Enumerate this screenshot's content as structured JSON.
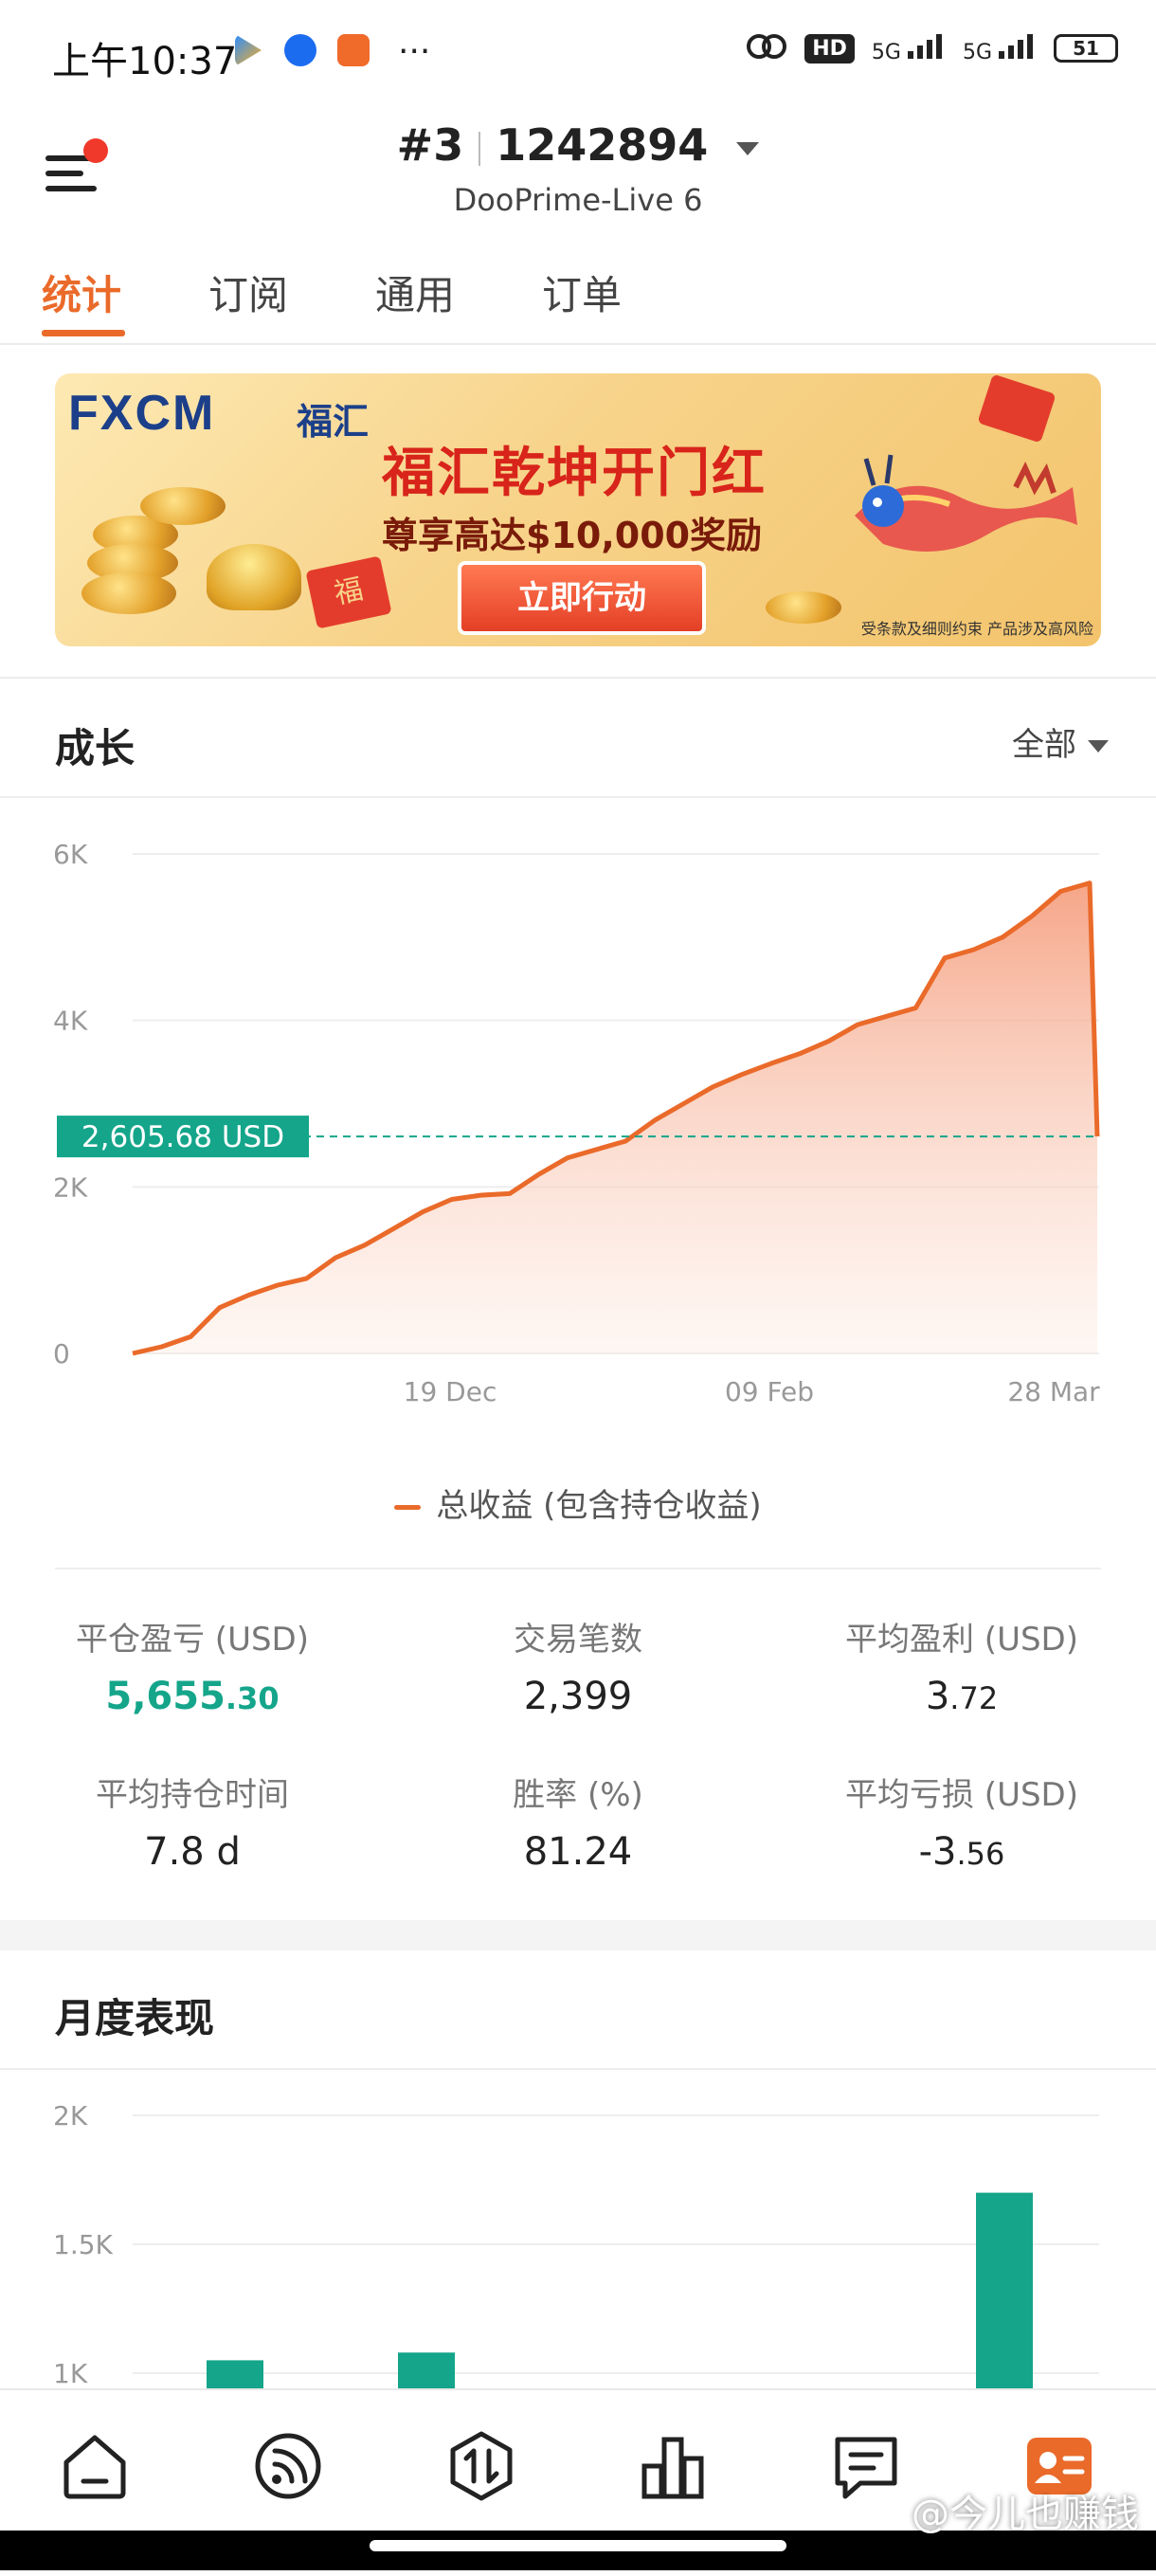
{
  "status_bar": {
    "time": "上午10:37",
    "more": "···",
    "hd": "HD",
    "sig1": "5G",
    "sig2": "5G",
    "battery": "51"
  },
  "header": {
    "account_index": "#3",
    "account_number": "1242894",
    "server": "DooPrime-Live 6"
  },
  "tabs": [
    {
      "label": "统计",
      "active": true
    },
    {
      "label": "订阅",
      "active": false
    },
    {
      "label": "通用",
      "active": false
    },
    {
      "label": "订单",
      "active": false
    }
  ],
  "banner": {
    "logo": "FXCM",
    "logo_cn": "福汇",
    "headline": "福汇乾坤开门红",
    "subline": "尊享高达$10,000奖励",
    "cta": "立即行动",
    "disclaimer": "受条款及细则约束  产品涉及高风险",
    "hongbao_char": "福"
  },
  "growth": {
    "title": "成长",
    "filter": "全部",
    "legend": "总收益 (包含持仓收益)",
    "current_label": "2,605.68 USD",
    "colors": {
      "line": "#ea6a2a",
      "accent": "#14a58a"
    }
  },
  "chart_data": [
    {
      "type": "area",
      "title": "",
      "xlabel": "",
      "ylabel": "",
      "x_ticks": [
        "19 Dec",
        "09 Feb",
        "28 Mar"
      ],
      "y_ticks": [
        "0",
        "2K",
        "4K",
        "6K"
      ],
      "ylim": [
        0,
        6000
      ],
      "current_value": 2605.68,
      "series": [
        {
          "name": "总收益 (包含持仓收益)",
          "values": [
            0,
            80,
            200,
            550,
            700,
            820,
            900,
            1150,
            1300,
            1500,
            1700,
            1850,
            1900,
            1920,
            2150,
            2350,
            2450,
            2550,
            2800,
            3000,
            3200,
            3350,
            3480,
            3600,
            3750,
            3950,
            4050,
            4150,
            4750,
            4850,
            5000,
            5250,
            5550,
            5650,
            2605.68
          ]
        }
      ],
      "grid": true
    },
    {
      "type": "bar",
      "title": "",
      "y_ticks": [
        "1K",
        "1.5K",
        "2K"
      ],
      "ylim": [
        1000,
        2000
      ],
      "series": [
        {
          "values": [
            1050,
            1080,
            1700
          ]
        }
      ],
      "grid": true
    }
  ],
  "stats": [
    {
      "label": "平仓盈亏 (USD)",
      "int": "5,655",
      "dec": ".30",
      "green": true
    },
    {
      "label": "交易笔数",
      "int": "2,399",
      "dec": "",
      "green": false
    },
    {
      "label": "平均盈利 (USD)",
      "int": "3",
      "dec": ".72",
      "green": false
    },
    {
      "label": "平均持仓时间",
      "int": "7.8 d",
      "dec": "",
      "green": false
    },
    {
      "label": "胜率 (%)",
      "int": "81.24",
      "dec": "",
      "green": false
    },
    {
      "label": "平均亏损 (USD)",
      "int": "-3",
      "dec": ".56",
      "green": false
    }
  ],
  "monthly": {
    "title": "月度表现"
  },
  "watermark": "@今儿也赚钱"
}
